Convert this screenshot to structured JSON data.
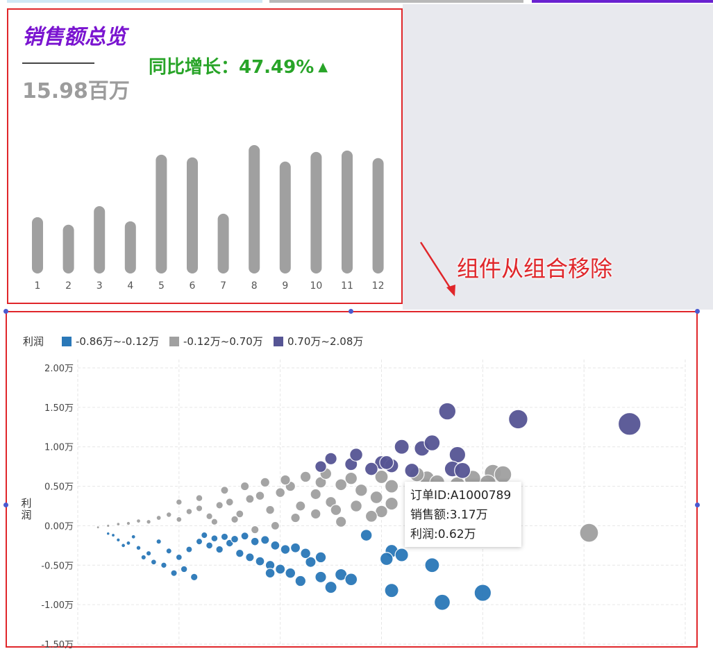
{
  "colors": {
    "title": "#7a14d0",
    "growth": "#28a428",
    "bar": "#a0a0a0",
    "annotation": "#e0262a",
    "series": [
      "#2a78b8",
      "#a0a0a0",
      "#565594"
    ],
    "tab_segments": [
      "#cfe8f5",
      "#b8b8b8",
      "#6a22d0"
    ]
  },
  "overview": {
    "title": "销售额总览",
    "total": "15.98百万",
    "growth_label": "同比增长：47.49%",
    "growth_icon": "triangle-up-icon"
  },
  "annotation": {
    "text": "组件从组合移除",
    "icon": "arrow-icon"
  },
  "tooltip": {
    "order_id": "订单ID:A1000789",
    "sales": "销售额:3.17万",
    "profit": "利润:0.62万"
  },
  "chart_data": [
    {
      "type": "bar",
      "categories": [
        "1",
        "2",
        "3",
        "4",
        "5",
        "6",
        "7",
        "8",
        "9",
        "10",
        "11",
        "12"
      ],
      "values": [
        0.82,
        0.71,
        0.98,
        0.76,
        1.73,
        1.69,
        0.87,
        1.87,
        1.63,
        1.77,
        1.79,
        1.68
      ],
      "title": "",
      "xlabel": "",
      "ylabel": "",
      "ylim": [
        0,
        1.87
      ],
      "grid": false
    },
    {
      "type": "scatter",
      "title": "",
      "xlabel": "",
      "ylabel": "利润",
      "legend_title": "利润",
      "legend_position": "top-left",
      "grid": true,
      "ylim": [
        -1.5,
        2.0
      ],
      "y_ticks": [
        "2.00万",
        "1.50万",
        "1.00万",
        "0.50万",
        "0.00万",
        "-0.50万",
        "-1.00万",
        "-1.50万"
      ],
      "xlim": [
        0,
        6
      ],
      "series": [
        {
          "name": "-0.86万~-0.12万",
          "points": [
            [
              1.2,
              -0.2
            ],
            [
              1.3,
              -0.25
            ],
            [
              1.4,
              -0.3
            ],
            [
              1.5,
              -0.22
            ],
            [
              1.6,
              -0.35
            ],
            [
              1.7,
              -0.4
            ],
            [
              1.8,
              -0.45
            ],
            [
              1.9,
              -0.5
            ],
            [
              2.0,
              -0.55
            ],
            [
              2.1,
              -0.6
            ],
            [
              2.2,
              -0.7
            ],
            [
              2.4,
              -0.65
            ],
            [
              2.5,
              -0.78
            ],
            [
              2.6,
              -0.62
            ],
            [
              3.1,
              -0.32
            ],
            [
              3.2,
              -0.37
            ],
            [
              2.4,
              -0.4
            ],
            [
              2.85,
              -0.12
            ],
            [
              3.5,
              -0.5
            ],
            [
              3.6,
              -0.97
            ],
            [
              4.0,
              -0.85
            ],
            [
              2.3,
              -0.46
            ],
            [
              1.9,
              -0.6
            ],
            [
              2.7,
              -0.68
            ],
            [
              3.1,
              -0.82
            ],
            [
              3.05,
              -0.42
            ],
            [
              0.3,
              -0.1
            ],
            [
              0.4,
              -0.18
            ],
            [
              0.5,
              -0.22
            ],
            [
              0.6,
              -0.28
            ],
            [
              0.7,
              -0.35
            ],
            [
              0.8,
              -0.2
            ],
            [
              0.9,
              -0.32
            ],
            [
              1.0,
              -0.4
            ],
            [
              1.1,
              -0.3
            ],
            [
              0.35,
              -0.12
            ],
            [
              0.45,
              -0.25
            ],
            [
              0.55,
              -0.14
            ],
            [
              0.65,
              -0.4
            ],
            [
              0.75,
              -0.46
            ],
            [
              0.85,
              -0.5
            ],
            [
              0.95,
              -0.6
            ],
            [
              1.05,
              -0.55
            ],
            [
              1.15,
              -0.65
            ],
            [
              1.25,
              -0.12
            ],
            [
              1.35,
              -0.16
            ],
            [
              1.45,
              -0.14
            ],
            [
              1.55,
              -0.17
            ],
            [
              1.65,
              -0.13
            ],
            [
              1.75,
              -0.2
            ],
            [
              1.85,
              -0.18
            ],
            [
              1.95,
              -0.25
            ],
            [
              2.05,
              -0.3
            ],
            [
              2.15,
              -0.28
            ],
            [
              2.25,
              -0.35
            ]
          ],
          "size": "proportional to sales"
        },
        {
          "name": "-0.12万~0.70万",
          "points": [
            [
              4.1,
              0.67
            ],
            [
              3.75,
              0.52
            ],
            [
              4.05,
              0.54
            ],
            [
              3.0,
              0.18
            ],
            [
              3.5,
              0.3
            ],
            [
              2.6,
              0.05
            ],
            [
              2.9,
              0.12
            ],
            [
              3.3,
              0.22
            ],
            [
              3.65,
              0.4
            ],
            [
              3.9,
              0.6
            ],
            [
              3.95,
              0.45
            ],
            [
              4.2,
              0.65
            ],
            [
              3.45,
              0.6
            ],
            [
              3.1,
              0.5
            ],
            [
              2.8,
              0.45
            ],
            [
              2.5,
              0.3
            ],
            [
              2.2,
              0.25
            ],
            [
              1.9,
              0.2
            ],
            [
              1.6,
              0.15
            ],
            [
              1.3,
              0.12
            ],
            [
              1.0,
              0.08
            ],
            [
              0.7,
              0.05
            ],
            [
              0.4,
              0.02
            ],
            [
              2.1,
              0.5
            ],
            [
              2.4,
              0.55
            ],
            [
              2.7,
              0.6
            ],
            [
              3.0,
              0.62
            ],
            [
              3.35,
              0.65
            ],
            [
              5.05,
              -0.09
            ],
            [
              3.1,
              0.28
            ],
            [
              3.3,
              0.42
            ],
            [
              3.55,
              0.55
            ],
            [
              2.35,
              0.4
            ],
            [
              2.6,
              0.52
            ],
            [
              2.95,
              0.36
            ],
            [
              0.2,
              -0.02
            ],
            [
              0.3,
              0.0
            ],
            [
              0.5,
              0.03
            ],
            [
              0.6,
              0.06
            ],
            [
              0.8,
              0.1
            ],
            [
              0.9,
              0.14
            ],
            [
              1.1,
              0.18
            ],
            [
              1.2,
              0.22
            ],
            [
              1.4,
              0.26
            ],
            [
              1.5,
              0.3
            ],
            [
              1.7,
              0.34
            ],
            [
              1.8,
              0.38
            ],
            [
              2.0,
              0.42
            ],
            [
              1.45,
              0.45
            ],
            [
              1.65,
              0.5
            ],
            [
              1.85,
              0.55
            ],
            [
              2.05,
              0.58
            ],
            [
              2.25,
              0.62
            ],
            [
              2.45,
              0.66
            ],
            [
              1.0,
              0.3
            ],
            [
              1.2,
              0.35
            ],
            [
              1.35,
              0.05
            ],
            [
              1.55,
              0.08
            ],
            [
              1.75,
              -0.05
            ],
            [
              1.95,
              0.0
            ],
            [
              2.15,
              0.1
            ],
            [
              2.35,
              0.15
            ],
            [
              2.55,
              0.2
            ],
            [
              2.75,
              0.25
            ]
          ],
          "size": "proportional to sales"
        },
        {
          "name": "0.70万~2.08万",
          "points": [
            [
              3.65,
              1.45
            ],
            [
              4.35,
              1.35
            ],
            [
              5.45,
              1.29
            ],
            [
              3.75,
              0.9
            ],
            [
              2.4,
              0.75
            ],
            [
              2.5,
              0.85
            ],
            [
              2.7,
              0.78
            ],
            [
              2.75,
              0.9
            ],
            [
              3.0,
              0.8
            ],
            [
              3.2,
              1.0
            ],
            [
              3.4,
              0.98
            ],
            [
              3.5,
              1.05
            ],
            [
              3.1,
              0.76
            ],
            [
              3.3,
              0.7
            ],
            [
              3.7,
              0.72
            ],
            [
              3.8,
              0.7
            ],
            [
              2.9,
              0.72
            ],
            [
              3.05,
              0.8
            ]
          ],
          "size": "proportional to sales"
        }
      ]
    }
  ]
}
